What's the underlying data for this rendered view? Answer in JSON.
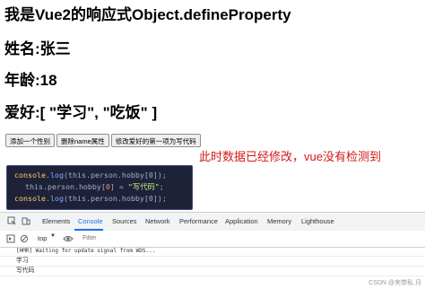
{
  "page": {
    "title": "我是Vue2的响应式Object.defineProperty",
    "name_line": "姓名:张三",
    "age_line": "年龄:18",
    "hobby_line": "爱好:[ \"学习\", \"吃饭\" ]",
    "buttons": [
      "添加一个性别",
      "删除name属性",
      "修改爱好的第一项为写代码"
    ],
    "note": "此时数据已经修改，vue没有检测到"
  },
  "code_snippet": {
    "line1": {
      "obj": "console",
      "fn": "log",
      "args": "this.person.hobby[0]);"
    },
    "line2": {
      "prefix": "this.person.hobby[",
      "index": "0",
      "suffix": "] = ",
      "str": "\"写代码\"",
      "end": ";"
    },
    "line3": {
      "obj": "console",
      "fn": "log",
      "args": "this.person.hobby[0]);"
    }
  },
  "devtools": {
    "tabs": [
      "Elements",
      "Console",
      "Sources",
      "Network",
      "Performance",
      "Application",
      "Memory",
      "Lighthouse"
    ],
    "active_tab": "Console",
    "context": "top",
    "filter_placeholder": "Filter",
    "console_lines": [
      "[HMR] Waiting for update signal from WDS...",
      "学习",
      "写代码"
    ]
  },
  "watermark": "CSDN @夹带私 月",
  "colors": {
    "note": "#d51818",
    "active_tab": "#1a73e8",
    "code_bg": "#1e2238"
  }
}
